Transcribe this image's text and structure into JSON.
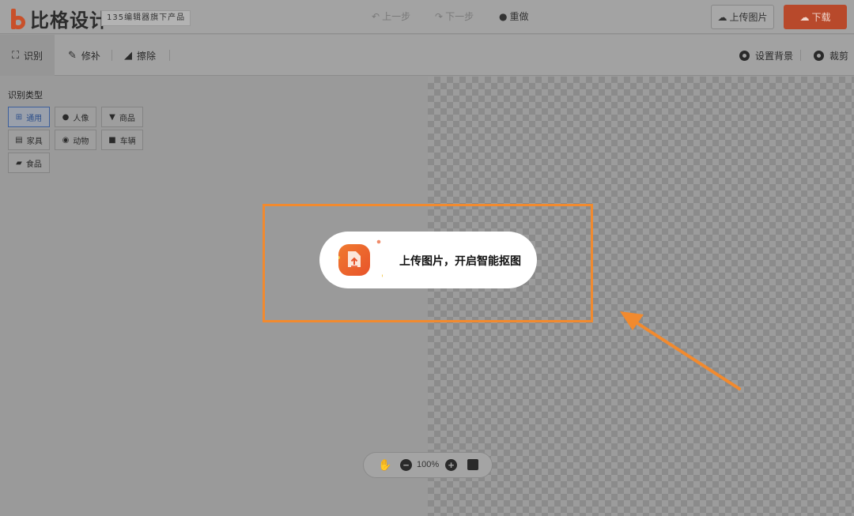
{
  "header": {
    "logo_text": "比格设计",
    "badge": "135编辑器旗下产品",
    "undo_label": "上一步",
    "redo_label": "下一步",
    "redo_all_label": "重做",
    "upload_label": "上传图片",
    "download_label": "下载"
  },
  "toolbar": {
    "recognize_label": "识别",
    "repair_label": "修补",
    "erase_label": "擦除",
    "background_label": "设置背景",
    "crop_label": "裁剪"
  },
  "sidebar": {
    "title": "识别类型",
    "types": [
      {
        "label": "通用",
        "icon": "grid-icon",
        "selected": true
      },
      {
        "label": "人像",
        "icon": "person-icon",
        "selected": false
      },
      {
        "label": "商品",
        "icon": "shirt-icon",
        "selected": false
      },
      {
        "label": "家具",
        "icon": "cabinet-icon",
        "selected": false
      },
      {
        "label": "动物",
        "icon": "animal-icon",
        "selected": false
      },
      {
        "label": "车辆",
        "icon": "truck-icon",
        "selected": false
      },
      {
        "label": "食品",
        "icon": "food-icon",
        "selected": false
      }
    ]
  },
  "canvas": {
    "upload_prompt": "上传图片，开启智能抠图"
  },
  "zoom": {
    "level": "100%"
  },
  "colors": {
    "accent": "#f28a2e",
    "download": "#b8492b",
    "selected_border": "#3d5f9a"
  }
}
